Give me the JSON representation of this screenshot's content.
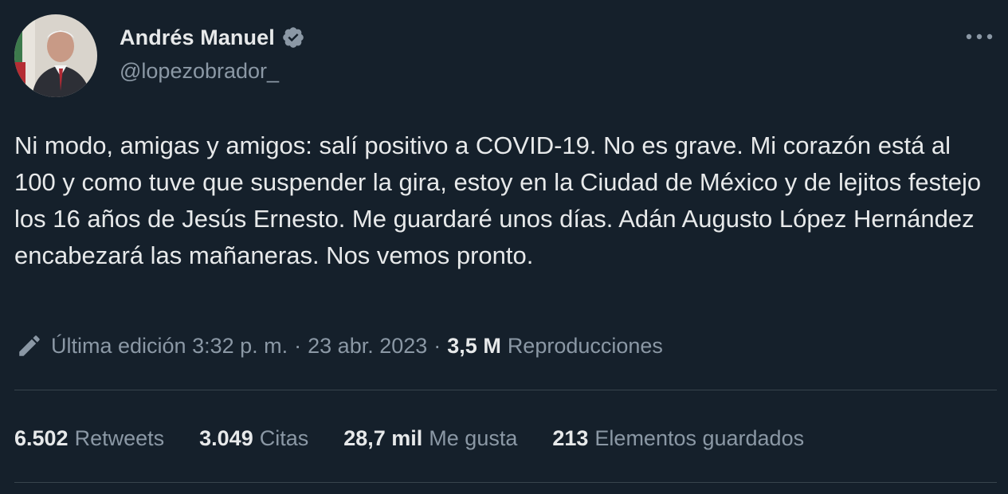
{
  "author": {
    "display_name": "Andrés Manuel",
    "handle": "@lopezobrador_",
    "verified": true
  },
  "tweet": {
    "text": "Ni modo, amigas y amigos: salí positivo a COVID-19. No es grave. Mi corazón está al 100 y como tuve que suspender la gira, estoy en la Ciudad de México y de lejitos festejo los 16 años de Jesús Ernesto. Me guardaré unos días. Adán Augusto López Hernández encabezará las mañaneras. Nos vemos pronto."
  },
  "meta": {
    "edited_label": "Última edición 3:32 p. m.",
    "separator": "·",
    "date": "23 abr. 2023",
    "views_count": "3,5 M",
    "views_label": "Reproducciones"
  },
  "stats": {
    "retweets": {
      "count": "6.502",
      "label": "Retweets"
    },
    "quotes": {
      "count": "3.049",
      "label": "Citas"
    },
    "likes": {
      "count": "28,7 mil",
      "label": "Me gusta"
    },
    "bookmarks": {
      "count": "213",
      "label": "Elementos guardados"
    }
  },
  "icons": {
    "verified": "verified-badge-icon",
    "more": "more-options-icon",
    "edit": "edit-pencil-icon"
  },
  "colors": {
    "background": "#15202b",
    "text_primary": "#e7e9ea",
    "text_secondary": "#8b98a5",
    "divider": "#38444d",
    "verified": "#8b98a5"
  }
}
